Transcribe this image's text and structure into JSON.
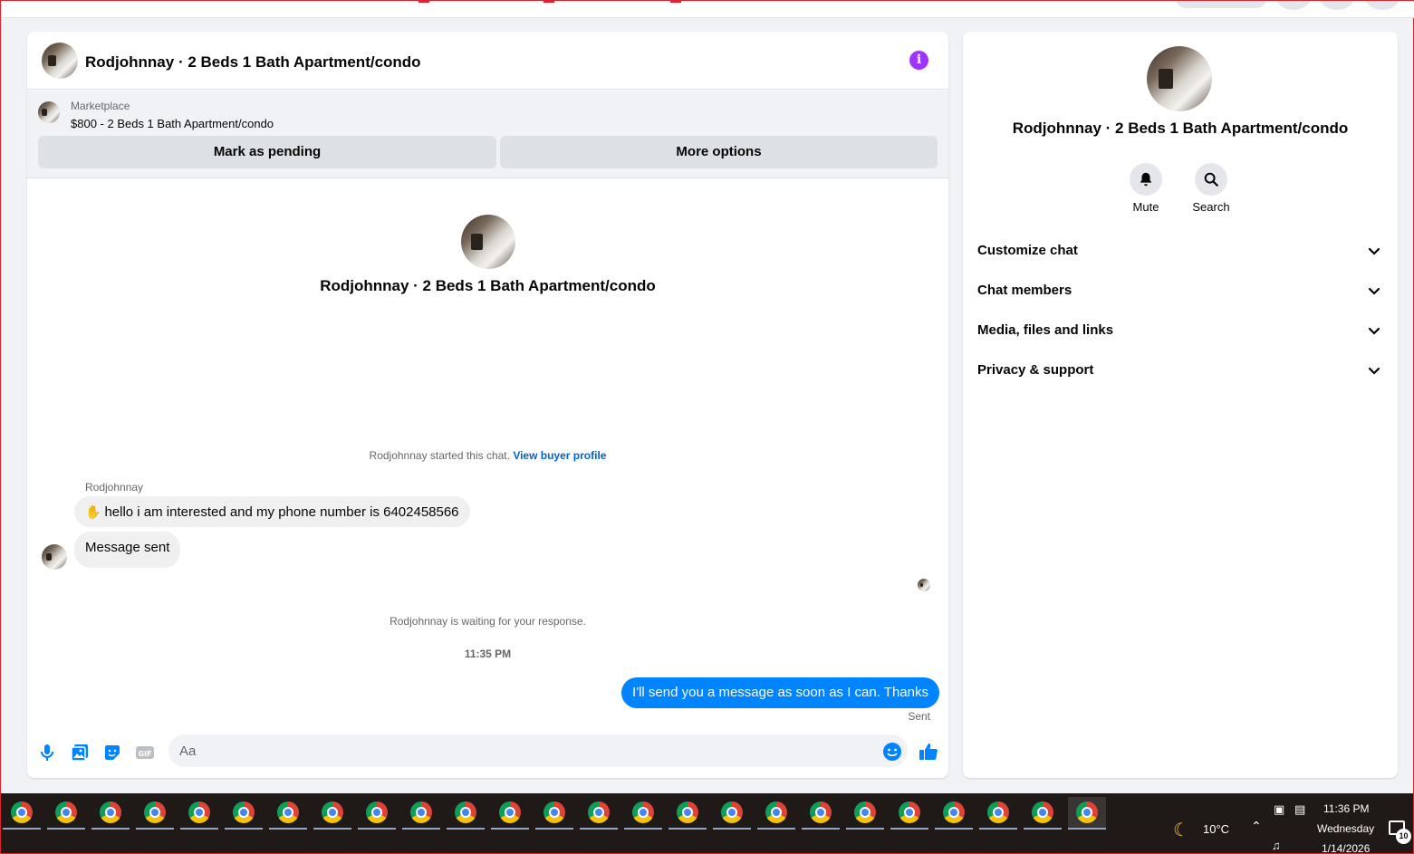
{
  "chat": {
    "title": "Rodjohnnay · 2 Beds 1 Bath Apartment/condo",
    "marketplace_label": "Marketplace",
    "listing": "$800 - 2 Beds 1 Bath Apartment/condo",
    "mark_pending_label": "Mark as pending",
    "more_options_label": "More options",
    "intro_name": "Rodjohnnay · 2 Beds 1 Bath Apartment/condo",
    "started_text": "Rodjohnnay started this chat.",
    "view_buyer_profile": "View buyer profile",
    "sender_name": "Rodjohnnay",
    "messages_in": [
      "hello i am interested and my phone number is 6402458566",
      "Message sent"
    ],
    "waiting_text": "Rodjohnnay is waiting for your response.",
    "timestamp": "11:35 PM",
    "message_out": "I'll send you a message as soon as I can. Thanks",
    "sent_status": "Sent",
    "input_placeholder": "Aa"
  },
  "sidebar": {
    "title": "Rodjohnnay · 2 Beds 1 Bath Apartment/condo",
    "actions": [
      {
        "label": "Mute",
        "icon": "bell-icon"
      },
      {
        "label": "Search",
        "icon": "search-icon"
      }
    ],
    "sections": [
      {
        "label": "Customize chat"
      },
      {
        "label": "Chat members"
      },
      {
        "label": "Media, files and links"
      },
      {
        "label": "Privacy & support"
      }
    ]
  },
  "taskbar": {
    "app_icon": "chrome-icon",
    "app_count": 25,
    "temperature": "10°C",
    "time": "11:36 PM",
    "day": "Wednesday",
    "date": "1/14/2026",
    "notification_count": "10"
  },
  "colors": {
    "accent": "#0084ff",
    "info": "#a033ff",
    "link": "#0064d1",
    "frame": "#d8262f"
  }
}
